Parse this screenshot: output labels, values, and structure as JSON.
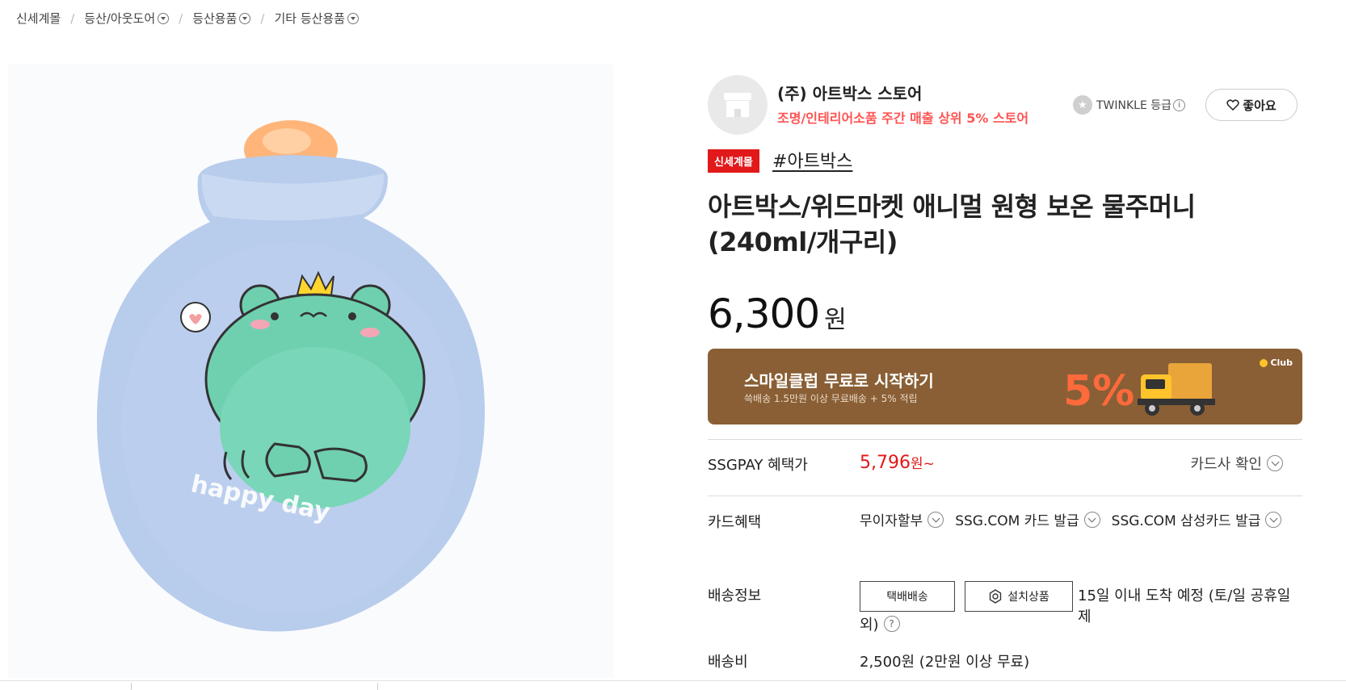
{
  "breadcrumb": [
    {
      "label": "신세계몰",
      "dropdown": false
    },
    {
      "label": "등산/아웃도어",
      "dropdown": true
    },
    {
      "label": "등산용품",
      "dropdown": true
    },
    {
      "label": "기타 등산용품",
      "dropdown": true
    }
  ],
  "breadcrumb_sep": "/",
  "product_image": {
    "icon": "frog-hot-water-bag-image",
    "print_text": "happy day"
  },
  "store": {
    "name": "(주) 아트박스 스토어",
    "sub": "조명/인테리어소품 주간 매출 상위 5% 스토어",
    "grade_label": "TWINKLE 등급",
    "like_label": "좋아요"
  },
  "badge": "신세계몰",
  "hashtag": "#아트박스",
  "product": {
    "title": "아트박스/위드마켓 애니멀 원형 보온 물주머니(240ml/개구리)",
    "price": "6,300",
    "currency": "원"
  },
  "smile_club": {
    "title": "스마일클럽 무료로 시작하기",
    "sub": "쓱배송 1.5만원 이상 무료배송 + 5% 적립",
    "badge": "Club",
    "percent": "5%"
  },
  "ssgpay": {
    "label": "SSGPAY 혜택가",
    "price": "5,796",
    "suffix": "원~",
    "card_check": "카드사 확인"
  },
  "card_benefit": {
    "label": "카드혜택",
    "items": [
      "무이자할부",
      "SSG.COM 카드 발급",
      "SSG.COM 삼성카드 발급"
    ]
  },
  "shipping": {
    "label": "배송정보",
    "btn_delivery": "택배배송",
    "btn_install": "설치상품",
    "info_line1": "15일 이내 도착 예정 (토/일 공휴일 제",
    "info_line2": "외)"
  },
  "shipping_fee": {
    "label": "배송비",
    "value": "2,500원 (2만원 이상 무료)"
  },
  "colors": {
    "accent_red": "#e2191a",
    "store_sub": "#ff5452",
    "banner": "#8a5f35"
  }
}
